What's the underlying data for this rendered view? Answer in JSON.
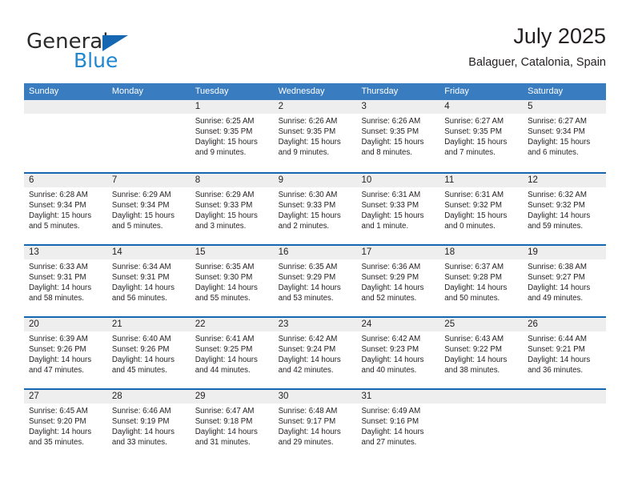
{
  "brand": {
    "name_part1": "General",
    "name_part2": "Blue"
  },
  "header": {
    "title": "July 2025",
    "location": "Balaguer, Catalonia, Spain"
  },
  "weekdays": [
    "Sunday",
    "Monday",
    "Tuesday",
    "Wednesday",
    "Thursday",
    "Friday",
    "Saturday"
  ],
  "colors": {
    "header_bar": "#3a7cc0",
    "row_divider": "#1567b2",
    "day_number_band": "#eeeeee",
    "brand_blue": "#1f86d0",
    "text": "#231f20"
  },
  "labels": {
    "sunrise_prefix": "Sunrise:",
    "sunset_prefix": "Sunset:",
    "daylight_prefix": "Daylight:"
  },
  "weeks": [
    [
      {
        "day": "",
        "empty": true
      },
      {
        "day": "",
        "empty": true
      },
      {
        "day": "1",
        "sunrise": "Sunrise: 6:25 AM",
        "sunset": "Sunset: 9:35 PM",
        "daylight_line1": "Daylight: 15 hours",
        "daylight_line2": "and 9 minutes."
      },
      {
        "day": "2",
        "sunrise": "Sunrise: 6:26 AM",
        "sunset": "Sunset: 9:35 PM",
        "daylight_line1": "Daylight: 15 hours",
        "daylight_line2": "and 9 minutes."
      },
      {
        "day": "3",
        "sunrise": "Sunrise: 6:26 AM",
        "sunset": "Sunset: 9:35 PM",
        "daylight_line1": "Daylight: 15 hours",
        "daylight_line2": "and 8 minutes."
      },
      {
        "day": "4",
        "sunrise": "Sunrise: 6:27 AM",
        "sunset": "Sunset: 9:35 PM",
        "daylight_line1": "Daylight: 15 hours",
        "daylight_line2": "and 7 minutes."
      },
      {
        "day": "5",
        "sunrise": "Sunrise: 6:27 AM",
        "sunset": "Sunset: 9:34 PM",
        "daylight_line1": "Daylight: 15 hours",
        "daylight_line2": "and 6 minutes."
      }
    ],
    [
      {
        "day": "6",
        "sunrise": "Sunrise: 6:28 AM",
        "sunset": "Sunset: 9:34 PM",
        "daylight_line1": "Daylight: 15 hours",
        "daylight_line2": "and 5 minutes."
      },
      {
        "day": "7",
        "sunrise": "Sunrise: 6:29 AM",
        "sunset": "Sunset: 9:34 PM",
        "daylight_line1": "Daylight: 15 hours",
        "daylight_line2": "and 5 minutes."
      },
      {
        "day": "8",
        "sunrise": "Sunrise: 6:29 AM",
        "sunset": "Sunset: 9:33 PM",
        "daylight_line1": "Daylight: 15 hours",
        "daylight_line2": "and 3 minutes."
      },
      {
        "day": "9",
        "sunrise": "Sunrise: 6:30 AM",
        "sunset": "Sunset: 9:33 PM",
        "daylight_line1": "Daylight: 15 hours",
        "daylight_line2": "and 2 minutes."
      },
      {
        "day": "10",
        "sunrise": "Sunrise: 6:31 AM",
        "sunset": "Sunset: 9:33 PM",
        "daylight_line1": "Daylight: 15 hours",
        "daylight_line2": "and 1 minute."
      },
      {
        "day": "11",
        "sunrise": "Sunrise: 6:31 AM",
        "sunset": "Sunset: 9:32 PM",
        "daylight_line1": "Daylight: 15 hours",
        "daylight_line2": "and 0 minutes."
      },
      {
        "day": "12",
        "sunrise": "Sunrise: 6:32 AM",
        "sunset": "Sunset: 9:32 PM",
        "daylight_line1": "Daylight: 14 hours",
        "daylight_line2": "and 59 minutes."
      }
    ],
    [
      {
        "day": "13",
        "sunrise": "Sunrise: 6:33 AM",
        "sunset": "Sunset: 9:31 PM",
        "daylight_line1": "Daylight: 14 hours",
        "daylight_line2": "and 58 minutes."
      },
      {
        "day": "14",
        "sunrise": "Sunrise: 6:34 AM",
        "sunset": "Sunset: 9:31 PM",
        "daylight_line1": "Daylight: 14 hours",
        "daylight_line2": "and 56 minutes."
      },
      {
        "day": "15",
        "sunrise": "Sunrise: 6:35 AM",
        "sunset": "Sunset: 9:30 PM",
        "daylight_line1": "Daylight: 14 hours",
        "daylight_line2": "and 55 minutes."
      },
      {
        "day": "16",
        "sunrise": "Sunrise: 6:35 AM",
        "sunset": "Sunset: 9:29 PM",
        "daylight_line1": "Daylight: 14 hours",
        "daylight_line2": "and 53 minutes."
      },
      {
        "day": "17",
        "sunrise": "Sunrise: 6:36 AM",
        "sunset": "Sunset: 9:29 PM",
        "daylight_line1": "Daylight: 14 hours",
        "daylight_line2": "and 52 minutes."
      },
      {
        "day": "18",
        "sunrise": "Sunrise: 6:37 AM",
        "sunset": "Sunset: 9:28 PM",
        "daylight_line1": "Daylight: 14 hours",
        "daylight_line2": "and 50 minutes."
      },
      {
        "day": "19",
        "sunrise": "Sunrise: 6:38 AM",
        "sunset": "Sunset: 9:27 PM",
        "daylight_line1": "Daylight: 14 hours",
        "daylight_line2": "and 49 minutes."
      }
    ],
    [
      {
        "day": "20",
        "sunrise": "Sunrise: 6:39 AM",
        "sunset": "Sunset: 9:26 PM",
        "daylight_line1": "Daylight: 14 hours",
        "daylight_line2": "and 47 minutes."
      },
      {
        "day": "21",
        "sunrise": "Sunrise: 6:40 AM",
        "sunset": "Sunset: 9:26 PM",
        "daylight_line1": "Daylight: 14 hours",
        "daylight_line2": "and 45 minutes."
      },
      {
        "day": "22",
        "sunrise": "Sunrise: 6:41 AM",
        "sunset": "Sunset: 9:25 PM",
        "daylight_line1": "Daylight: 14 hours",
        "daylight_line2": "and 44 minutes."
      },
      {
        "day": "23",
        "sunrise": "Sunrise: 6:42 AM",
        "sunset": "Sunset: 9:24 PM",
        "daylight_line1": "Daylight: 14 hours",
        "daylight_line2": "and 42 minutes."
      },
      {
        "day": "24",
        "sunrise": "Sunrise: 6:42 AM",
        "sunset": "Sunset: 9:23 PM",
        "daylight_line1": "Daylight: 14 hours",
        "daylight_line2": "and 40 minutes."
      },
      {
        "day": "25",
        "sunrise": "Sunrise: 6:43 AM",
        "sunset": "Sunset: 9:22 PM",
        "daylight_line1": "Daylight: 14 hours",
        "daylight_line2": "and 38 minutes."
      },
      {
        "day": "26",
        "sunrise": "Sunrise: 6:44 AM",
        "sunset": "Sunset: 9:21 PM",
        "daylight_line1": "Daylight: 14 hours",
        "daylight_line2": "and 36 minutes."
      }
    ],
    [
      {
        "day": "27",
        "sunrise": "Sunrise: 6:45 AM",
        "sunset": "Sunset: 9:20 PM",
        "daylight_line1": "Daylight: 14 hours",
        "daylight_line2": "and 35 minutes."
      },
      {
        "day": "28",
        "sunrise": "Sunrise: 6:46 AM",
        "sunset": "Sunset: 9:19 PM",
        "daylight_line1": "Daylight: 14 hours",
        "daylight_line2": "and 33 minutes."
      },
      {
        "day": "29",
        "sunrise": "Sunrise: 6:47 AM",
        "sunset": "Sunset: 9:18 PM",
        "daylight_line1": "Daylight: 14 hours",
        "daylight_line2": "and 31 minutes."
      },
      {
        "day": "30",
        "sunrise": "Sunrise: 6:48 AM",
        "sunset": "Sunset: 9:17 PM",
        "daylight_line1": "Daylight: 14 hours",
        "daylight_line2": "and 29 minutes."
      },
      {
        "day": "31",
        "sunrise": "Sunrise: 6:49 AM",
        "sunset": "Sunset: 9:16 PM",
        "daylight_line1": "Daylight: 14 hours",
        "daylight_line2": "and 27 minutes."
      },
      {
        "day": "",
        "empty": true
      },
      {
        "day": "",
        "empty": true
      }
    ]
  ]
}
